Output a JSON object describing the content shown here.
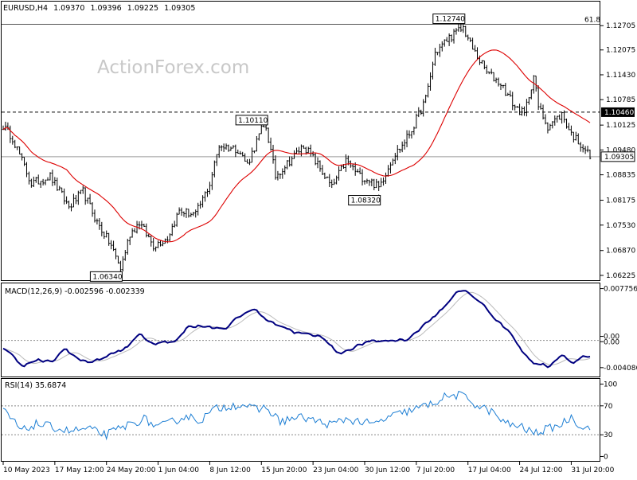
{
  "chart_data": [
    {
      "type": "candlestick",
      "header": {
        "symbol": "EURUSD,H4",
        "open": "1.09370",
        "high": "1.09396",
        "low": "1.09225",
        "close": "1.09305"
      },
      "watermark": "ActionForex.com",
      "y_tick_labels": [
        "1.12705",
        "1.12075",
        "1.11430",
        "1.10785",
        "1.10460",
        "1.10125",
        "1.09480",
        "1.09305",
        "1.08835",
        "1.08175",
        "1.07530",
        "1.06870",
        "1.06225"
      ],
      "ylim": [
        1.061,
        1.1302
      ],
      "current_price": "1.09305",
      "current_price_value": 1.09305,
      "level_label": "1.10460",
      "level_value": 1.1046,
      "fib_label": "61.8",
      "fib_value": 1.1274,
      "annotations": [
        {
          "label": "1.12740",
          "value": 1.1274
        },
        {
          "label": "1.10110",
          "value": 1.1011
        },
        {
          "label": "1.08320",
          "value": 1.0832
        },
        {
          "label": "1.06340",
          "value": 1.0634
        }
      ],
      "series_colors": {
        "ma": "#dd0000",
        "bars": "#000000"
      },
      "anchors": [
        [
          0,
          1.101
        ],
        [
          4,
          1.098
        ],
        [
          8,
          1.092
        ],
        [
          12,
          1.086
        ],
        [
          20,
          1.088
        ],
        [
          28,
          1.08
        ],
        [
          34,
          1.084
        ],
        [
          40,
          1.076
        ],
        [
          46,
          1.07
        ],
        [
          50,
          1.064
        ],
        [
          54,
          1.073
        ],
        [
          58,
          1.076
        ],
        [
          64,
          1.07
        ],
        [
          70,
          1.072
        ],
        [
          75,
          1.079
        ],
        [
          82,
          1.078
        ],
        [
          88,
          1.086
        ],
        [
          92,
          1.096
        ],
        [
          100,
          1.095
        ],
        [
          104,
          1.091
        ],
        [
          110,
          1.1
        ],
        [
          112,
          1.1008
        ],
        [
          116,
          1.088
        ],
        [
          122,
          1.092
        ],
        [
          128,
          1.096
        ],
        [
          134,
          1.091
        ],
        [
          140,
          1.085
        ],
        [
          146,
          1.092
        ],
        [
          152,
          1.088
        ],
        [
          156,
          1.087
        ],
        [
          160,
          1.085
        ],
        [
          166,
          1.093
        ],
        [
          170,
          1.096
        ],
        [
          174,
          1.1
        ],
        [
          180,
          1.108
        ],
        [
          184,
          1.12
        ],
        [
          190,
          1.124
        ],
        [
          196,
          1.1265
        ],
        [
          200,
          1.121
        ],
        [
          206,
          1.115
        ],
        [
          212,
          1.112
        ],
        [
          218,
          1.106
        ],
        [
          222,
          1.104
        ],
        [
          226,
          1.114
        ],
        [
          228,
          1.106
        ],
        [
          232,
          1.101
        ],
        [
          238,
          1.104
        ],
        [
          242,
          1.099
        ],
        [
          248,
          1.095
        ],
        [
          250,
          1.093
        ]
      ]
    },
    {
      "type": "line",
      "title": "MACD(12,26,9) -0.002596 -0.002339",
      "y_tick_labels": [
        "0.007756",
        "0.00",
        "0.00",
        "-0.004086"
      ],
      "ylim": [
        -0.0053,
        0.0083
      ],
      "series_colors": {
        "main": "#000080",
        "signal": "#bbbbbb"
      },
      "anchors": [
        [
          0,
          -0.0012
        ],
        [
          8,
          -0.0038
        ],
        [
          14,
          -0.003
        ],
        [
          20,
          -0.0033
        ],
        [
          26,
          -0.0012
        ],
        [
          32,
          -0.003
        ],
        [
          38,
          -0.0032
        ],
        [
          46,
          -0.002
        ],
        [
          52,
          -0.0012
        ],
        [
          58,
          0.0012
        ],
        [
          62,
          -0.0006
        ],
        [
          66,
          -0.0003
        ],
        [
          72,
          -0.0003
        ],
        [
          78,
          0.002
        ],
        [
          84,
          0.0022
        ],
        [
          88,
          0.002
        ],
        [
          94,
          0.0018
        ],
        [
          100,
          0.0035
        ],
        [
          106,
          0.0048
        ],
        [
          112,
          0.003
        ],
        [
          118,
          0.0022
        ],
        [
          124,
          0.0012
        ],
        [
          130,
          0.0008
        ],
        [
          136,
          0.0005
        ],
        [
          142,
          -0.002
        ],
        [
          148,
          -0.0012
        ],
        [
          154,
          -0.0003
        ],
        [
          160,
          -0.0001
        ],
        [
          166,
          0.0
        ],
        [
          172,
          0.0002
        ],
        [
          178,
          0.002
        ],
        [
          186,
          0.0045
        ],
        [
          192,
          0.007
        ],
        [
          196,
          0.0075
        ],
        [
          202,
          0.006
        ],
        [
          210,
          0.003
        ],
        [
          216,
          0.001
        ],
        [
          220,
          -0.0015
        ],
        [
          226,
          -0.0035
        ],
        [
          232,
          -0.0038
        ],
        [
          238,
          -0.002
        ],
        [
          242,
          -0.0035
        ],
        [
          246,
          -0.0025
        ],
        [
          250,
          -0.0027
        ]
      ]
    },
    {
      "type": "line",
      "title": "RSI(14) 35.6874",
      "y_tick_labels": [
        "100",
        "70",
        "30",
        "0"
      ],
      "ylim": [
        -5,
        105
      ],
      "levels": [
        70,
        30
      ],
      "series_colors": {
        "rsi": "#1e7fd4"
      },
      "anchors": [
        [
          0,
          65
        ],
        [
          8,
          35
        ],
        [
          14,
          45
        ],
        [
          22,
          40
        ],
        [
          28,
          35
        ],
        [
          36,
          38
        ],
        [
          44,
          30
        ],
        [
          52,
          42
        ],
        [
          60,
          52
        ],
        [
          66,
          40
        ],
        [
          72,
          48
        ],
        [
          78,
          56
        ],
        [
          84,
          50
        ],
        [
          90,
          65
        ],
        [
          96,
          70
        ],
        [
          102,
          72
        ],
        [
          108,
          64
        ],
        [
          112,
          68
        ],
        [
          118,
          48
        ],
        [
          122,
          52
        ],
        [
          128,
          54
        ],
        [
          134,
          48
        ],
        [
          140,
          44
        ],
        [
          146,
          52
        ],
        [
          152,
          48
        ],
        [
          158,
          44
        ],
        [
          164,
          54
        ],
        [
          170,
          60
        ],
        [
          176,
          66
        ],
        [
          182,
          72
        ],
        [
          188,
          82
        ],
        [
          194,
          85
        ],
        [
          198,
          80
        ],
        [
          202,
          70
        ],
        [
          208,
          62
        ],
        [
          214,
          45
        ],
        [
          220,
          42
        ],
        [
          226,
          32
        ],
        [
          232,
          38
        ],
        [
          238,
          45
        ],
        [
          242,
          55
        ],
        [
          246,
          42
        ],
        [
          250,
          38
        ]
      ]
    }
  ],
  "x_tick_labels": [
    "10 May 2023",
    "17 May 12:00",
    "24 May 20:00",
    "1 Jun 04:00",
    "8 Jun 12:00",
    "15 Jun 20:00",
    "23 Jun 04:00",
    "30 Jun 12:00",
    "7 Jul 20:00",
    "17 Jul 04:00",
    "24 Jul 12:00",
    "31 Jul 20:00"
  ],
  "x_tick_bar_index": [
    0,
    22,
    44,
    66,
    88,
    110,
    132,
    154,
    176,
    198,
    220,
    242
  ],
  "bar_count": 251
}
